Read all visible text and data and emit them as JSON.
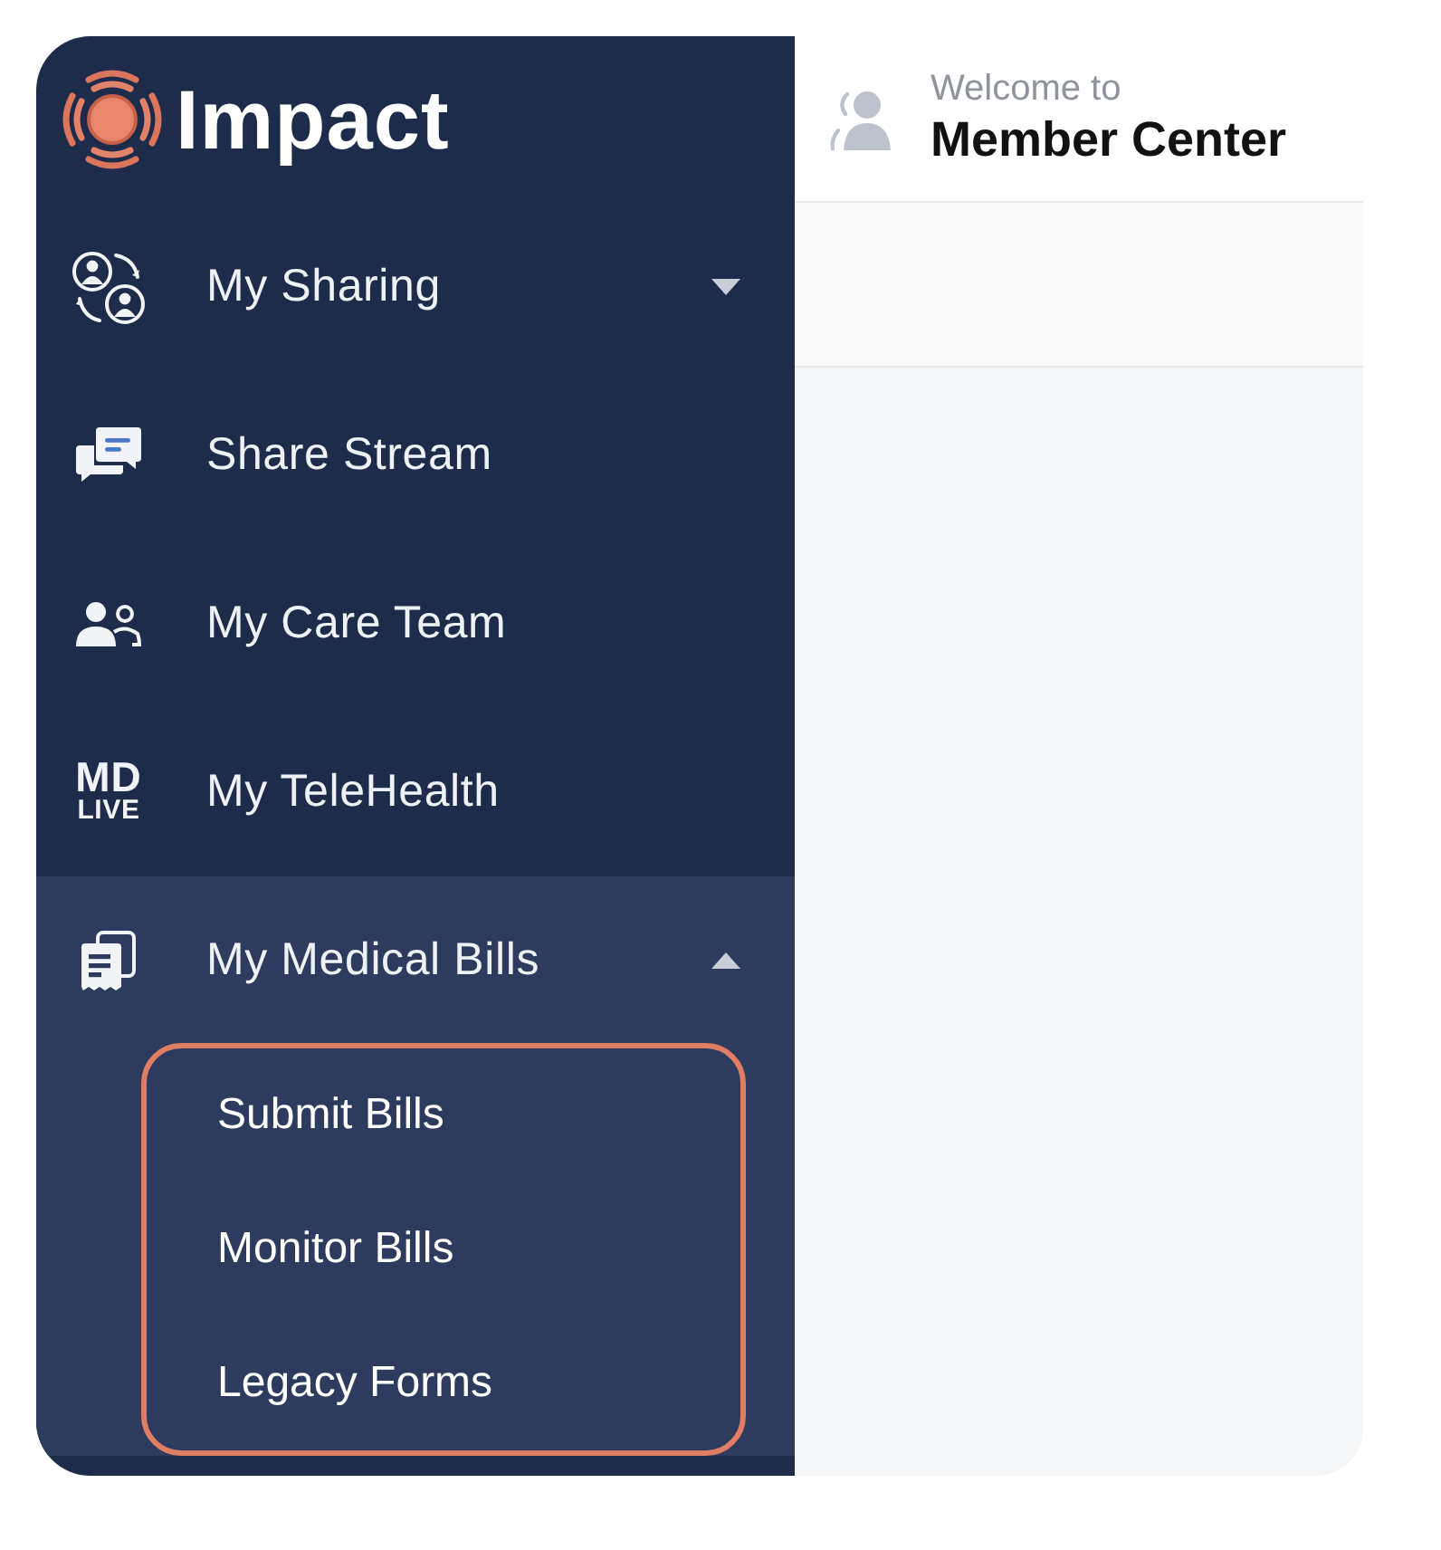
{
  "brand": {
    "name": "Impact"
  },
  "sidebar": {
    "items": [
      {
        "kind": "group",
        "label": "My Sharing",
        "expanded": false,
        "selected": false
      },
      {
        "kind": "link",
        "label": "Share Stream",
        "selected": false
      },
      {
        "kind": "link",
        "label": "My Care Team",
        "selected": false
      },
      {
        "kind": "link",
        "label": "My TeleHealth",
        "icon_text": [
          "MD",
          "LIVE"
        ],
        "selected": false
      },
      {
        "kind": "group",
        "label": "My Medical Bills",
        "expanded": true,
        "selected": false,
        "children": [
          {
            "label": "Submit Bills",
            "selected": false
          },
          {
            "label": "Monitor Bills",
            "selected": false
          },
          {
            "label": "Legacy Forms",
            "selected": false
          }
        ]
      }
    ]
  },
  "header": {
    "greeting": "Welcome to",
    "title": "Member Center"
  }
}
